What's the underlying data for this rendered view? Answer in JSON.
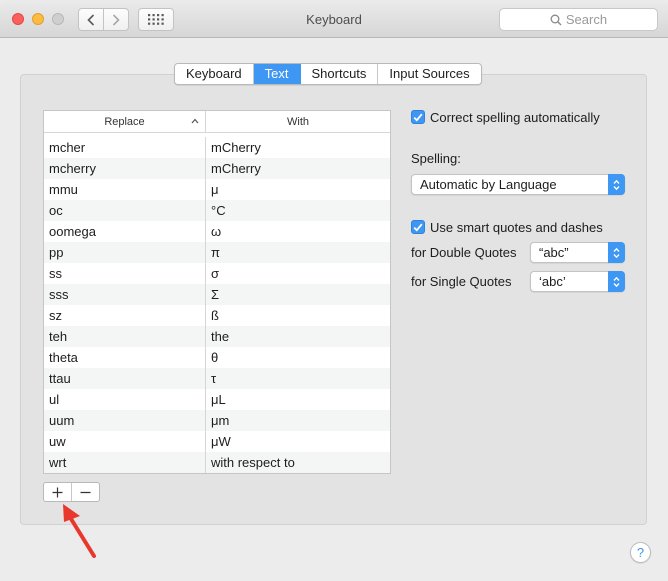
{
  "window": {
    "title": "Keyboard",
    "search_placeholder": "Search"
  },
  "tabs": [
    {
      "label": "Keyboard",
      "active": false
    },
    {
      "label": "Text",
      "active": true
    },
    {
      "label": "Shortcuts",
      "active": false
    },
    {
      "label": "Input Sources",
      "active": false
    }
  ],
  "table": {
    "headers": {
      "replace": "Replace",
      "with": "With"
    },
    "rows": [
      {
        "replace": "mcher",
        "with": "mCherry"
      },
      {
        "replace": "mcherry",
        "with": "mCherry"
      },
      {
        "replace": "mmu",
        "with": "μ"
      },
      {
        "replace": "oc",
        "with": "°C"
      },
      {
        "replace": "oomega",
        "with": "ω"
      },
      {
        "replace": "pp",
        "with": "π"
      },
      {
        "replace": "ss",
        "with": "σ"
      },
      {
        "replace": "sss",
        "with": "Σ"
      },
      {
        "replace": "sz",
        "with": "ß"
      },
      {
        "replace": "teh",
        "with": "the"
      },
      {
        "replace": "theta",
        "with": "θ"
      },
      {
        "replace": "ttau",
        "with": "τ"
      },
      {
        "replace": "ul",
        "with": "μL"
      },
      {
        "replace": "uum",
        "with": "μm"
      },
      {
        "replace": "uw",
        "with": "μW"
      },
      {
        "replace": "wrt",
        "with": "with respect to"
      }
    ]
  },
  "options": {
    "correct_spelling": {
      "label": "Correct spelling automatically",
      "checked": true
    },
    "spelling_label": "Spelling:",
    "spelling_value": "Automatic by Language",
    "smart_quotes": {
      "label": "Use smart quotes and dashes",
      "checked": true
    },
    "double_quotes_label": "for Double Quotes",
    "double_quotes_value": "“abc”",
    "single_quotes_label": "for Single Quotes",
    "single_quotes_value": "‘abc’"
  },
  "buttons": {
    "plus": "+",
    "minus": "−",
    "help": "?"
  },
  "colors": {
    "accent": "#3f97f4",
    "annotation_arrow": "#e8372c"
  }
}
